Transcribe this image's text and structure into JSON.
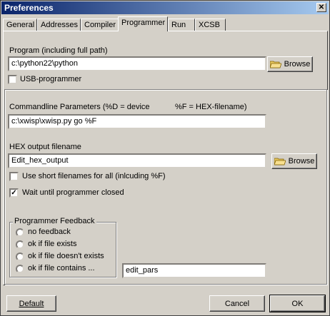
{
  "window": {
    "title": "Preferences",
    "close_glyph": "✕"
  },
  "tabs": [
    {
      "label": "General"
    },
    {
      "label": "Addresses"
    },
    {
      "label": "Compiler"
    },
    {
      "label": "Programmer"
    },
    {
      "label": "Run"
    },
    {
      "label": "XCSB"
    }
  ],
  "program": {
    "label": "Program (including full path)",
    "value": "c:\\python22\\python",
    "browse_label": "Browse",
    "usb_label": "USB-programmer",
    "usb_checked": false
  },
  "commandline": {
    "label": "Commandline Parameters  (%D = device",
    "label_hint": "%F = HEX-filename)",
    "value": "c:\\xwisp\\xwisp.py go %F"
  },
  "hex_output": {
    "label": "HEX output filename",
    "value": "Edit_hex_output",
    "browse_label": "Browse"
  },
  "options": {
    "short_filenames_label": "Use short filenames for all (inlcuding %F)",
    "short_filenames_checked": false,
    "wait_label": "Wait until programmer closed",
    "wait_checked": true,
    "check_glyph": "✓"
  },
  "feedback": {
    "legend": "Programmer Feedback",
    "options": [
      {
        "label": "no feedback"
      },
      {
        "label": "ok if file exists"
      },
      {
        "label": "ok if file doesn't exists"
      },
      {
        "label": "ok if file contains ..."
      }
    ],
    "contains_value": "edit_pars"
  },
  "footer": {
    "default_label": "Default",
    "cancel_label": "Cancel",
    "ok_label": "OK"
  },
  "icons": {
    "browse": "folder-open-icon",
    "close": "close-icon",
    "check": "checkmark-icon"
  }
}
